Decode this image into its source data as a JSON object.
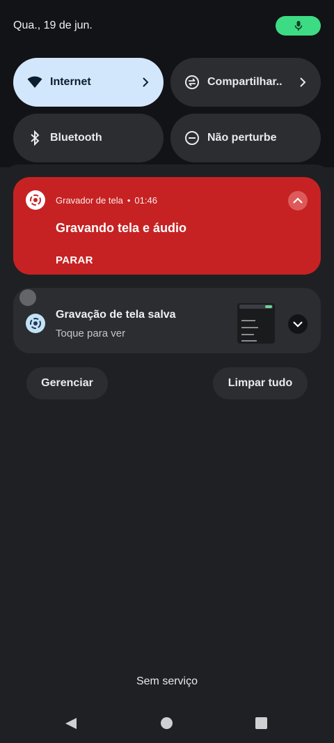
{
  "status": {
    "date": "Qua., 19 de jun."
  },
  "quick_settings": {
    "tiles": [
      {
        "label": "Internet",
        "icon": "wifi-icon",
        "active": true
      },
      {
        "label": "Compartilhar..",
        "icon": "share-sync-icon",
        "active": false
      },
      {
        "label": "Bluetooth",
        "icon": "bluetooth-icon",
        "active": false
      },
      {
        "label": "Não perturbe",
        "icon": "do-not-disturb-icon",
        "active": false
      }
    ]
  },
  "notifications": {
    "recording": {
      "app_name": "Gravador de tela",
      "separator": "•",
      "time": "01:46",
      "title": "Gravando tela e áudio",
      "action": "PARAR",
      "color": "#c62223"
    },
    "saved": {
      "title": "Gravação de tela salva",
      "subtitle": "Toque para ver"
    }
  },
  "actions": {
    "manage": "Gerenciar",
    "clear_all": "Limpar tudo"
  },
  "carrier": {
    "status": "Sem serviço"
  },
  "colors": {
    "accent": "#d3e7fc",
    "mic": "#3ddc84",
    "shade": "#1f2023"
  }
}
